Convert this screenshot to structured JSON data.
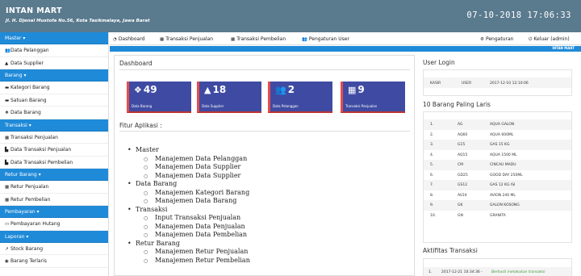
{
  "header": {
    "brand": "INTAN MART",
    "address": "Jl. H. Djenal Mustofa No.56, Kota Tasikmalaya, Jawa Barat",
    "clock": "07-10-2018 17:06:33"
  },
  "sidebar": {
    "sections": [
      {
        "label": "Master ▾",
        "items": [
          {
            "icon": "users-icon",
            "glyph": "👥",
            "label": "Data Pelanggan"
          },
          {
            "icon": "user-icon",
            "glyph": "▲",
            "label": "Data Supplier"
          }
        ]
      },
      {
        "label": "Barang ▾",
        "items": [
          {
            "icon": "folder-icon",
            "glyph": "▬",
            "label": "Kategori Barang"
          },
          {
            "icon": "folder-icon",
            "glyph": "▬",
            "label": "Satuan Barang"
          },
          {
            "icon": "cubes-icon",
            "glyph": "❖",
            "label": "Data Barang"
          }
        ]
      },
      {
        "label": "Transaksi ▾",
        "items": [
          {
            "icon": "cart-icon",
            "glyph": "▦",
            "label": "Transaksi Penjualan"
          },
          {
            "icon": "chart-icon",
            "glyph": "▙",
            "label": "Data Transaksi Penjualan"
          },
          {
            "icon": "chart-icon",
            "glyph": "▙",
            "label": "Data Transaksi Pembelian"
          }
        ]
      },
      {
        "label": "Retur Barang ▾",
        "items": [
          {
            "icon": "cart-icon",
            "glyph": "▦",
            "label": "Retur Penjualan"
          },
          {
            "icon": "cart-icon",
            "glyph": "▦",
            "label": "Retur Pembelian"
          }
        ]
      },
      {
        "label": "Pembayaran ▾",
        "items": [
          {
            "icon": "credit-card-icon",
            "glyph": "▭",
            "label": "Pembayaran Hutang"
          }
        ]
      },
      {
        "label": "Laporan ▾",
        "items": [
          {
            "icon": "line-chart-icon",
            "glyph": "↗",
            "label": "Stock Barang"
          },
          {
            "icon": "bullseye-icon",
            "glyph": "◉",
            "label": "Barang Terlaris"
          }
        ]
      }
    ]
  },
  "topnav": {
    "items": [
      {
        "icon": "dashboard-icon",
        "glyph": "◔",
        "label": "Dashboard"
      },
      {
        "icon": "cart-icon",
        "glyph": "▦",
        "label": "Transaksi Penjualan"
      },
      {
        "icon": "cart-icon",
        "glyph": "▦",
        "label": "Transaksi Pembelian"
      },
      {
        "icon": "users-icon",
        "glyph": "👥",
        "label": "Pengaturan User"
      }
    ],
    "right": [
      {
        "icon": "gear-icon",
        "glyph": "⚙",
        "label": "Pengaturan"
      },
      {
        "icon": "power-icon",
        "glyph": "⏻",
        "label": "Keluar (admin)"
      }
    ]
  },
  "strip": {
    "label": "INTAN MART"
  },
  "dashboard": {
    "title": "Dashboard",
    "tiles": [
      {
        "icon": "cubes-icon",
        "glyph": "❖",
        "value": "49",
        "label": "Data Barang"
      },
      {
        "icon": "user-icon",
        "glyph": "▲",
        "value": "18",
        "label": "Data Supplier"
      },
      {
        "icon": "users-icon",
        "glyph": "👥",
        "value": "2",
        "label": "Data Pelanggan"
      },
      {
        "icon": "cart-icon",
        "glyph": "▦",
        "value": "9",
        "label": "Transaksi Penjualan"
      }
    ],
    "fitur_title": "Fitur Aplikasi :",
    "fitur": [
      {
        "name": "Master",
        "children": [
          "Manajemen Data Pelanggan",
          "Manajemen Data Supplier",
          "Manajemen Data Supplier"
        ]
      },
      {
        "name": "Data Barang",
        "children": [
          "Manajemen Kategori Barang",
          "Manajemen Data Barang"
        ]
      },
      {
        "name": "Transaksi",
        "children": [
          "Input Transaksi Penjualan",
          "Manajemen Data Penjualan",
          "Manajemen Data Pembelian"
        ]
      },
      {
        "name": "Retur Barang",
        "children": [
          "Manajemen Retur Penjualan",
          "Manajemen Retur Pembelian"
        ]
      }
    ]
  },
  "user_login": {
    "title": "User Login",
    "row": {
      "role": "KASIR",
      "user": "USER",
      "time": "2017-12-10 12:10:06"
    }
  },
  "top_items": {
    "title": "10 Barang Paling Laris",
    "rows": [
      {
        "no": "1.",
        "code": "AG",
        "name": "AQUA GALON"
      },
      {
        "no": "2.",
        "code": "AQ60",
        "name": "AQUA 600ML"
      },
      {
        "no": "3.",
        "code": "G15",
        "name": "GAS 15 KG"
      },
      {
        "no": "4.",
        "code": "AQ15",
        "name": "AQUA 1500 ML"
      },
      {
        "no": "5.",
        "code": "CM",
        "name": "CINCAU MADU"
      },
      {
        "no": "6.",
        "code": "GD25",
        "name": "GOOD DAY 250ML"
      },
      {
        "no": "7.",
        "code": "GS12",
        "name": "GAS 12 KG ISI"
      },
      {
        "no": "8.",
        "code": "AV24",
        "name": "AVION 240 ML"
      },
      {
        "no": "9.",
        "code": "GK",
        "name": "GALON KOSONG"
      },
      {
        "no": "10.",
        "code": "GN",
        "name": "GRANITA"
      }
    ]
  },
  "activity": {
    "title": "Aktifitas Transaksi",
    "rows": [
      {
        "no": "1.",
        "time": "2017-12-21 10:34:36 -",
        "text": "Berhasil melakukan transaksi"
      }
    ]
  }
}
